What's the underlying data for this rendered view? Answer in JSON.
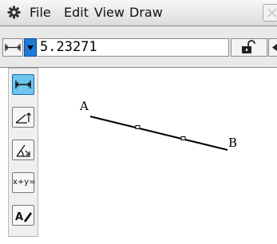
{
  "menu": {
    "items": [
      "File",
      "Edit",
      "View",
      "Draw"
    ]
  },
  "measurement": {
    "value": "5.23271"
  },
  "palette": {
    "tools": [
      "length",
      "angle-slope",
      "angle",
      "equation",
      "text"
    ],
    "equation_label": "x+y="
  },
  "geometry": {
    "point_a_label": "A",
    "point_b_label": "B"
  },
  "colors": {
    "active_tool": "#6ec5ee",
    "dropdown": "#1e7ad8"
  }
}
